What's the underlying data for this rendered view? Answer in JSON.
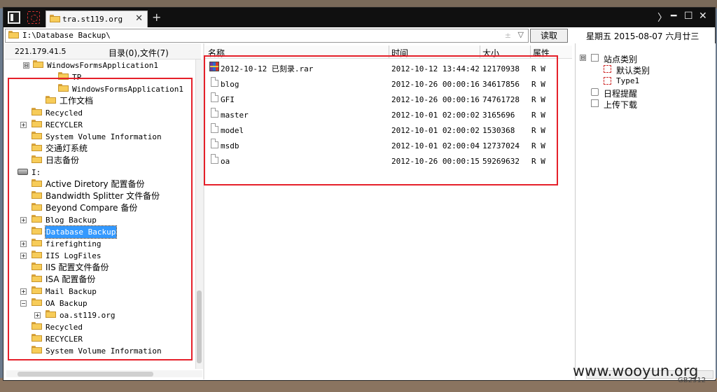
{
  "tab": {
    "title": "tra.st119.org",
    "close": "✕",
    "new": "+"
  },
  "window_controls": {
    "arrow": "〉",
    "minimize": "━",
    "maximize": "☐",
    "close": "✕"
  },
  "address": {
    "path": "I:\\Database Backup\\",
    "up_arrow": "±",
    "dropdown_arrow": "▽"
  },
  "read_button": "读取",
  "date": "星期五  2015-08-07  六月廿三",
  "left_header": {
    "ip": "221.179.41.5",
    "counts": "目录(0),文件(7)"
  },
  "tree": [
    {
      "label": "WindowsFormsApplication1",
      "expander": "⊟"
    },
    {
      "label": "TP"
    },
    {
      "label": "WindowsFormsApplication1"
    },
    {
      "label": "工作文档"
    },
    {
      "label": "Recycled"
    },
    {
      "label": "RECYCLER",
      "expander": "+"
    },
    {
      "label": "System Volume Information"
    },
    {
      "label": "交通灯系统"
    },
    {
      "label": "日志备份"
    },
    {
      "label": "I:",
      "expander": "⊟"
    },
    {
      "label": "Active Diretory 配置备份"
    },
    {
      "label": "Bandwidth Splitter 文件备份"
    },
    {
      "label": "Beyond Compare 备份"
    },
    {
      "label": "Blog Backup",
      "expander": "+"
    },
    {
      "label": "Database Backup",
      "selected": true
    },
    {
      "label": "firefighting",
      "expander": "+"
    },
    {
      "label": "IIS LogFiles",
      "expander": "+"
    },
    {
      "label": "IIS 配置文件备份"
    },
    {
      "label": "ISA 配置备份"
    },
    {
      "label": "Mail Backup",
      "expander": "+"
    },
    {
      "label": "OA Backup",
      "expander": "−"
    },
    {
      "label": "oa.st119.org",
      "expander": "+"
    },
    {
      "label": "Recycled"
    },
    {
      "label": "RECYCLER"
    },
    {
      "label": "System Volume Information"
    }
  ],
  "columns": {
    "name": "名称",
    "time": "时间",
    "size": "大小",
    "attr": "属性"
  },
  "files": [
    {
      "name": "2012-10-12 已刻录.rar",
      "time": "2012-10-12 13:44:42",
      "size": "12170938",
      "attr": "R W",
      "icon": "rar-icon"
    },
    {
      "name": "blog",
      "time": "2012-10-26 00:00:16",
      "size": "34617856",
      "attr": "R W",
      "icon": "file-icon"
    },
    {
      "name": "GFI",
      "time": "2012-10-26 00:00:16",
      "size": "74761728",
      "attr": "R W",
      "icon": "file-icon"
    },
    {
      "name": "master",
      "time": "2012-10-01 02:00:02",
      "size": "3165696",
      "attr": "R W",
      "icon": "file-icon"
    },
    {
      "name": "model",
      "time": "2012-10-01 02:00:02",
      "size": "1530368",
      "attr": "R W",
      "icon": "file-icon"
    },
    {
      "name": "msdb",
      "time": "2012-10-01 02:00:04",
      "size": "12737024",
      "attr": "R W",
      "icon": "file-icon"
    },
    {
      "name": "oa",
      "time": "2012-10-26 00:00:15",
      "size": "59269632",
      "attr": "R W",
      "icon": "file-icon"
    }
  ],
  "right_panel": {
    "site_categories": "站点类别",
    "default_category": "默认类别",
    "type1": "Type1",
    "schedule": "日程提醒",
    "transfer": "上传下载",
    "expander": "⊟"
  },
  "watermark": "www.wooyun.org",
  "gb_tag": "GB2312",
  "colors": {
    "selection": "#3399ff",
    "highlight_box": "#e5202a",
    "titlebar": "#101010"
  }
}
